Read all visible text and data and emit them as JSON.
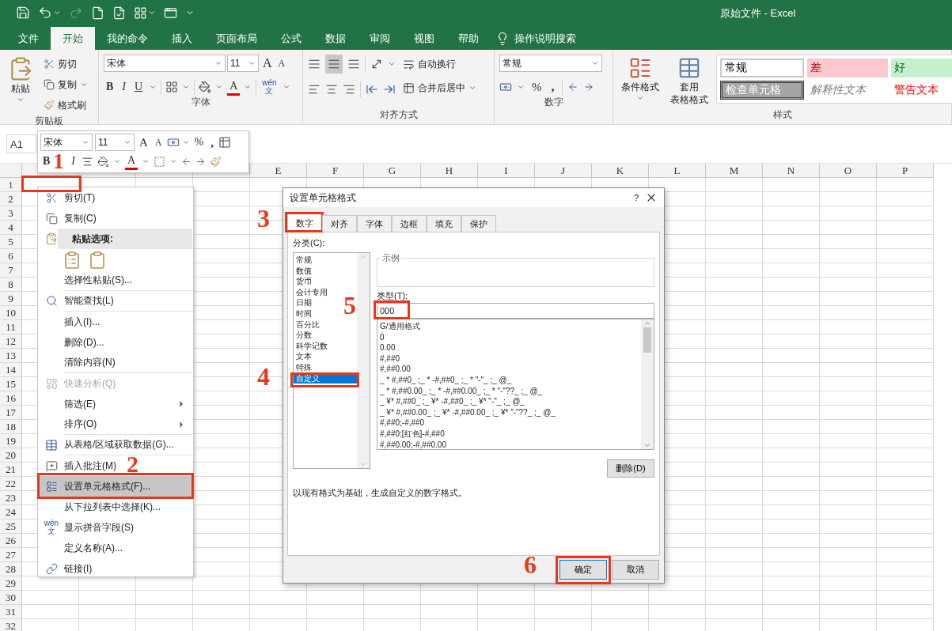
{
  "window": {
    "title": "原始文件 - Excel"
  },
  "ribbon_tabs": [
    {
      "label": "文件",
      "selected": false
    },
    {
      "label": "开始",
      "selected": true
    },
    {
      "label": "我的命令",
      "selected": false
    },
    {
      "label": "插入",
      "selected": false
    },
    {
      "label": "页面布局",
      "selected": false
    },
    {
      "label": "公式",
      "selected": false
    },
    {
      "label": "数据",
      "selected": false
    },
    {
      "label": "审阅",
      "selected": false
    },
    {
      "label": "视图",
      "selected": false
    },
    {
      "label": "帮助",
      "selected": false
    }
  ],
  "tell_me": "操作说明搜索",
  "ribbon": {
    "clipboard": {
      "paste": "粘贴",
      "cut": "剪切",
      "copy": "复制",
      "painter": "格式刷",
      "group": "剪贴板"
    },
    "font": {
      "name": "宋体",
      "size": "11",
      "grow": "A",
      "shrink": "A",
      "bold": "B",
      "italic": "I",
      "underline": "U",
      "font_color": "A",
      "phonetic_top": "wén",
      "phonetic_bottom": "文",
      "group": "字体"
    },
    "alignment": {
      "wrap": "自动换行",
      "merge": "合并后居中",
      "group": "对齐方式"
    },
    "number": {
      "format": "常规",
      "percent": "%",
      "comma": ",",
      "group": "数字"
    },
    "styles": {
      "conditional": "条件格式",
      "table_format_top": "套用",
      "table_format_bottom": "表格格式",
      "group": "样式",
      "cells": [
        {
          "label": "常规",
          "kind": "normal"
        },
        {
          "label": "差",
          "kind": "bad"
        },
        {
          "label": "好",
          "kind": "good"
        },
        {
          "label": "检查单元格",
          "kind": "check"
        },
        {
          "label": "解释性文本",
          "kind": "explanatory"
        },
        {
          "label": "警告文本",
          "kind": "warning"
        }
      ]
    }
  },
  "name_box": "A1",
  "mini_toolbar": {
    "font": "宋体",
    "size": "11",
    "grow": "A",
    "shrink": "A",
    "percent": "%",
    "comma": ",",
    "bold": "B",
    "italic": "I",
    "font_color": "A"
  },
  "sheet": {
    "columns": [
      "E",
      "F",
      "G",
      "H",
      "I",
      "J",
      "K",
      "L",
      "M",
      "N",
      "O",
      "P"
    ],
    "rows": [
      "1",
      "2",
      "3",
      "4",
      "5",
      "6",
      "7",
      "8",
      "9",
      "10",
      "11",
      "12",
      "13",
      "14",
      "15",
      "16",
      "17",
      "18",
      "19",
      "20",
      "21",
      "22",
      "23",
      "24",
      "25",
      "26",
      "27",
      "28",
      "29",
      "30",
      "31",
      "32"
    ]
  },
  "context_menu": {
    "items": [
      {
        "kind": "item",
        "label": "剪切(T)",
        "selected": false,
        "disabled": false,
        "submenu": false,
        "separator_after": false
      },
      {
        "kind": "item",
        "label": "复制(C)",
        "selected": false,
        "disabled": false,
        "submenu": false,
        "separator_after": false
      },
      {
        "kind": "header",
        "label": "粘贴选项:"
      },
      {
        "kind": "paste_icons"
      },
      {
        "kind": "item",
        "label": "选择性粘贴(S)...",
        "selected": false,
        "disabled": false,
        "submenu": false,
        "separator_after": true
      },
      {
        "kind": "item",
        "label": "智能查找(L)",
        "selected": false,
        "disabled": false,
        "submenu": false,
        "separator_after": true
      },
      {
        "kind": "item",
        "label": "插入(I)...",
        "selected": false,
        "disabled": false,
        "submenu": false,
        "separator_after": false
      },
      {
        "kind": "item",
        "label": "删除(D)...",
        "selected": false,
        "disabled": false,
        "submenu": false,
        "separator_after": false
      },
      {
        "kind": "item",
        "label": "清除内容(N)",
        "selected": false,
        "disabled": false,
        "submenu": false,
        "separator_after": true
      },
      {
        "kind": "item",
        "label": "快速分析(Q)",
        "selected": false,
        "disabled": true,
        "submenu": false,
        "separator_after": false
      },
      {
        "kind": "item",
        "label": "筛选(E)",
        "selected": false,
        "disabled": false,
        "submenu": true,
        "separator_after": false
      },
      {
        "kind": "item",
        "label": "排序(O)",
        "selected": false,
        "disabled": false,
        "submenu": true,
        "separator_after": true
      },
      {
        "kind": "item",
        "label": "从表格/区域获取数据(G)...",
        "selected": false,
        "disabled": false,
        "submenu": false,
        "separator_after": true
      },
      {
        "kind": "item",
        "label": "插入批注(M)",
        "selected": false,
        "disabled": false,
        "submenu": false,
        "separator_after": false
      },
      {
        "kind": "item",
        "label": "设置单元格格式(F)...",
        "selected": true,
        "disabled": false,
        "submenu": false,
        "separator_after": false
      },
      {
        "kind": "item",
        "label": "从下拉列表中选择(K)...",
        "selected": false,
        "disabled": false,
        "submenu": false,
        "separator_after": false
      },
      {
        "kind": "item",
        "label": "显示拼音字段(S)",
        "icon_top": "wén",
        "icon_bottom": "文",
        "selected": false,
        "disabled": false,
        "submenu": false,
        "separator_after": false
      },
      {
        "kind": "item",
        "label": "定义名称(A)...",
        "selected": false,
        "disabled": false,
        "submenu": false,
        "separator_after": false
      },
      {
        "kind": "item",
        "label": "链接(I)",
        "selected": false,
        "disabled": false,
        "submenu": false,
        "separator_after": false
      }
    ]
  },
  "dialog": {
    "title": "设置单元格格式",
    "help": "?",
    "tabs": [
      {
        "label": "数字",
        "selected": true
      },
      {
        "label": "对齐",
        "selected": false
      },
      {
        "label": "字体",
        "selected": false
      },
      {
        "label": "边框",
        "selected": false
      },
      {
        "label": "填充",
        "selected": false
      },
      {
        "label": "保护",
        "selected": false
      }
    ],
    "category_label": "分类(C):",
    "categories": [
      {
        "label": "常规",
        "selected": false
      },
      {
        "label": "数值",
        "selected": false
      },
      {
        "label": "货币",
        "selected": false
      },
      {
        "label": "会计专用",
        "selected": false
      },
      {
        "label": "日期",
        "selected": false
      },
      {
        "label": "时间",
        "selected": false
      },
      {
        "label": "百分比",
        "selected": false
      },
      {
        "label": "分数",
        "selected": false
      },
      {
        "label": "科学记数",
        "selected": false
      },
      {
        "label": "文本",
        "selected": false
      },
      {
        "label": "特殊",
        "selected": false
      },
      {
        "label": "自定义",
        "selected": true
      }
    ],
    "sample_label": "示例",
    "type_label": "类型(T):",
    "type_value": "000",
    "formats": [
      "G/通用格式",
      "0",
      "0.00",
      "#,##0",
      "#,##0.00",
      "_ * #,##0_ ;_ * -#,##0_ ;_ * \"-\"_ ;_ @_",
      "_ * #,##0.00_ ;_ * -#,##0.00_ ;_ * \"-\"??_ ;_ @_",
      "_ ¥* #,##0_ ;_ ¥* -#,##0_ ;_ ¥* \"-\"_ ;_ @_",
      "_ ¥* #,##0.00_ ;_ ¥* -#,##0.00_ ;_ ¥* \"-\"??_ ;_ @_",
      "#,##0;-#,##0",
      "#,##0;[红色]-#,##0",
      "#,##0.00;-#,##0.00"
    ],
    "delete": "删除(D)",
    "description": "以现有格式为基础，生成自定义的数字格式。",
    "ok": "确定",
    "cancel": "取消"
  },
  "annotations": [
    {
      "label": "1"
    },
    {
      "label": "2"
    },
    {
      "label": "3"
    },
    {
      "label": "4"
    },
    {
      "label": "5"
    },
    {
      "label": "6"
    }
  ]
}
